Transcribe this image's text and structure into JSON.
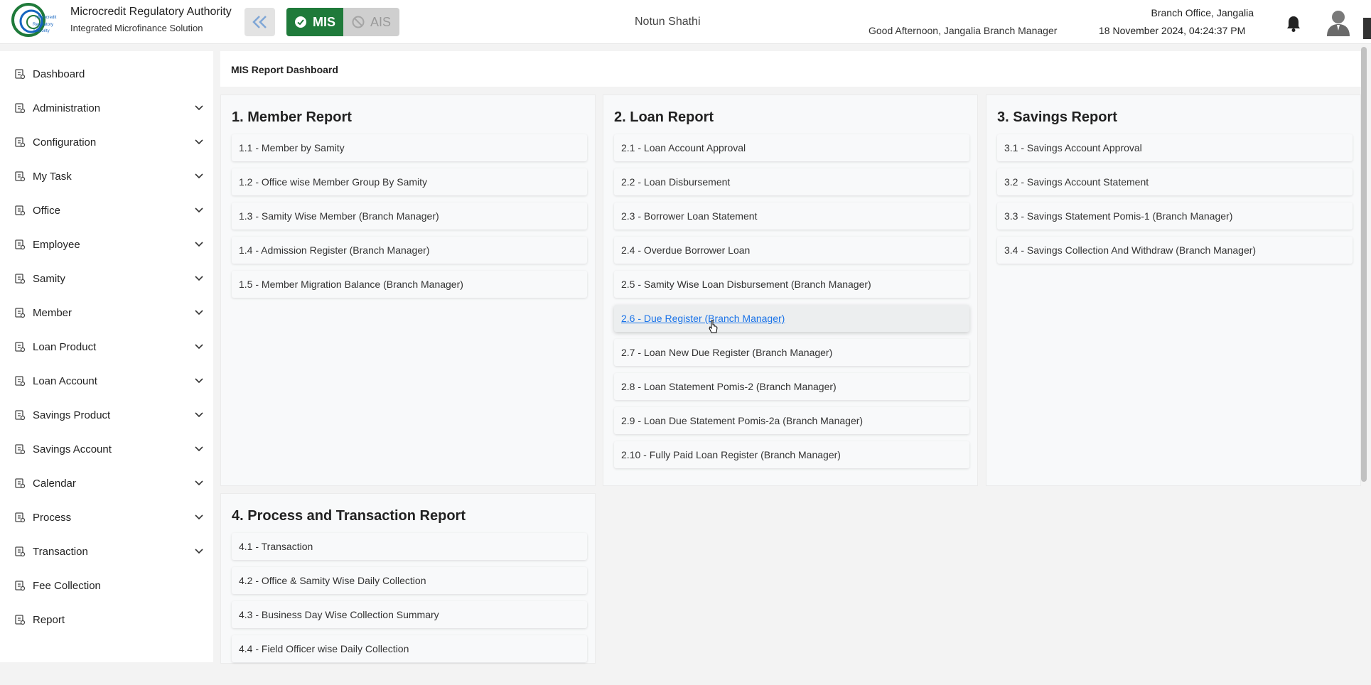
{
  "header": {
    "brand_title": "Microcredit Regulatory Authority",
    "brand_subtitle": "Integrated Microfinance Solution",
    "logo_text": "Microcredit Regulatory Authority",
    "mis_label": "MIS",
    "ais_label": "AIS",
    "org_name": "Notun Shathi",
    "greeting": "Good Afternoon, Jangalia Branch Manager",
    "office": "Branch Office, Jangalia",
    "datetime": "18 November 2024, 04:24:37 PM"
  },
  "sidebar": {
    "items": [
      {
        "label": "Dashboard",
        "icon": "dashboard-icon"
      },
      {
        "label": "Administration",
        "icon": "admin-icon"
      },
      {
        "label": "Configuration",
        "icon": "sliders-icon"
      },
      {
        "label": "My Task",
        "icon": "task-icon"
      },
      {
        "label": "Office",
        "icon": "office-icon"
      },
      {
        "label": "Employee",
        "icon": "employee-icon"
      },
      {
        "label": "Samity",
        "icon": "samity-icon"
      },
      {
        "label": "Member",
        "icon": "member-icon"
      },
      {
        "label": "Loan Product",
        "icon": "loan-product-icon"
      },
      {
        "label": "Loan Account",
        "icon": "loan-account-icon"
      },
      {
        "label": "Savings Product",
        "icon": "savings-product-icon"
      },
      {
        "label": "Savings Account",
        "icon": "savings-account-icon"
      },
      {
        "label": "Calendar",
        "icon": "calendar-icon"
      },
      {
        "label": "Process",
        "icon": "process-icon"
      },
      {
        "label": "Transaction",
        "icon": "transaction-icon"
      },
      {
        "label": "Fee Collection",
        "icon": "fee-collection-icon"
      },
      {
        "label": "Report",
        "icon": "report-icon"
      }
    ]
  },
  "main": {
    "page_title": "MIS Report Dashboard",
    "sections": [
      {
        "title": "1. Member Report",
        "items": [
          "1.1 - Member by Samity",
          "1.2 - Office wise Member Group By Samity",
          "1.3 - Samity Wise Member (Branch Manager)",
          "1.4 - Admission Register (Branch Manager)",
          "1.5 - Member Migration Balance (Branch Manager)"
        ]
      },
      {
        "title": "2. Loan Report",
        "items": [
          "2.1 - Loan Account Approval",
          "2.2 - Loan Disbursement",
          "2.3 - Borrower Loan Statement",
          "2.4 - Overdue Borrower Loan",
          "2.5 - Samity Wise Loan Disbursement (Branch Manager)",
          "2.6 - Due Register (Branch Manager)",
          "2.7 - Loan New Due Register (Branch Manager)",
          "2.8 - Loan Statement Pomis-2 (Branch Manager)",
          "2.9 - Loan Due Statement Pomis-2a (Branch Manager)",
          "2.10 - Fully Paid Loan Register (Branch Manager)"
        ]
      },
      {
        "title": "3. Savings Report",
        "items": [
          "3.1 - Savings Account Approval",
          "3.2 - Savings Account Statement",
          "3.3 - Savings Statement Pomis-1 (Branch Manager)",
          "3.4 - Savings Collection And Withdraw (Branch Manager)"
        ]
      },
      {
        "title": "4. Process and Transaction Report",
        "items": [
          "4.1 - Transaction",
          "4.2 - Office & Samity Wise Daily Collection",
          "4.3 - Business Day Wise Collection Summary",
          "4.4 - Field Officer wise Daily Collection"
        ]
      }
    ]
  },
  "colors": {
    "mis_green": "#1f7a3a",
    "link_blue": "#1a73e8"
  }
}
